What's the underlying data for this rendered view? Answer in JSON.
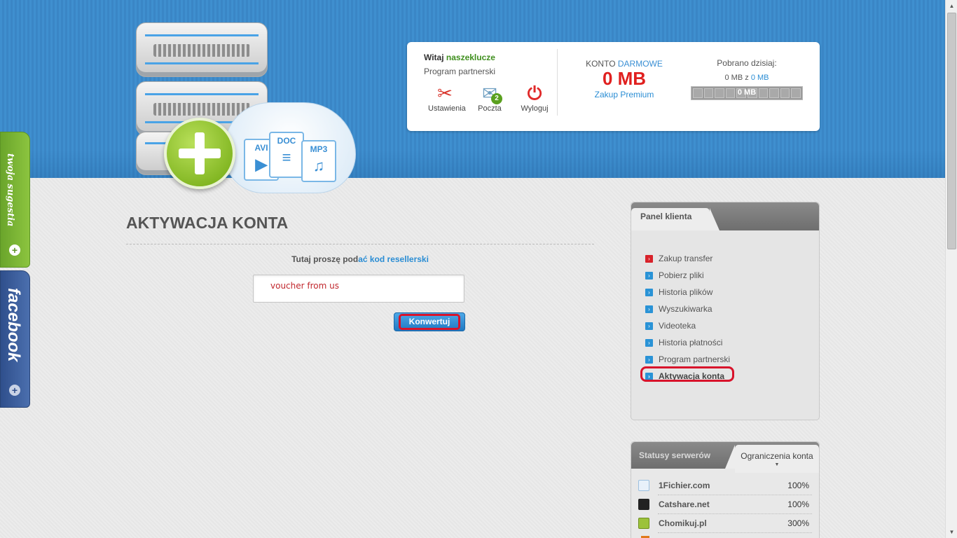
{
  "account": {
    "greeting": "Witaj",
    "username": "naszeklucze",
    "partner_program": "Program partnerski",
    "icons": [
      {
        "label": "Ustawienia",
        "icon": "tools-icon"
      },
      {
        "label": "Poczta",
        "icon": "mail-icon",
        "badge": "2"
      },
      {
        "label": "Wyloguj",
        "icon": "power-icon"
      }
    ],
    "konto_label": "KONTO",
    "konto_type": "DARMOWE",
    "konto_value": "0 MB",
    "premium_link": "Zakup Premium",
    "downloaded_label": "Pobrano dzisiaj:",
    "downloaded_used": "0 MB",
    "downloaded_of": "z",
    "downloaded_limit": "0 MB",
    "progress_text": "0 MB",
    "progress_fraction": 0
  },
  "hero": {
    "files": [
      "AVI",
      "DOC",
      "MP3"
    ]
  },
  "side_tabs": {
    "suggestion": "twoja sugestia",
    "facebook": "facebook"
  },
  "main": {
    "title": "AKTYWACJA KONTA",
    "hint_prefix": "Tutaj proszę pod",
    "hint_link": "ać kod resellerski",
    "voucher_value": "voucher from us",
    "submit_label": "Konwertuj"
  },
  "panel": {
    "tab": "Panel klienta",
    "items": [
      {
        "label": "Zakup transfer",
        "accent": "#d8222a"
      },
      {
        "label": "Pobierz pliki",
        "accent": "#2a93d6"
      },
      {
        "label": "Historia plików",
        "accent": "#2a93d6"
      },
      {
        "label": "Wyszukiwarka",
        "accent": "#2a93d6"
      },
      {
        "label": "Videoteka",
        "accent": "#2a93d6"
      },
      {
        "label": "Historia płatności",
        "accent": "#2a93d6"
      },
      {
        "label": "Program partnerski",
        "accent": "#2a93d6"
      },
      {
        "label": "Aktywacja konta",
        "accent": "#2a93d6"
      }
    ]
  },
  "status": {
    "tab_servers": "Statusy serwerów",
    "tab_limits": "Ograniczenia konta",
    "rows": [
      {
        "name": "1Fichier.com",
        "percent": "100%",
        "logo_color": "#e8f1fa"
      },
      {
        "name": "Catshare.net",
        "percent": "100%",
        "logo_color": "#222222"
      },
      {
        "name": "Chomikuj.pl",
        "percent": "300%",
        "logo_color": "#9cc23b"
      }
    ]
  },
  "colors": {
    "header_blue": "#3f8fcf",
    "accent_red": "#e0201f",
    "link_blue": "#2a8dd4",
    "highlight_red": "#d8132b"
  }
}
